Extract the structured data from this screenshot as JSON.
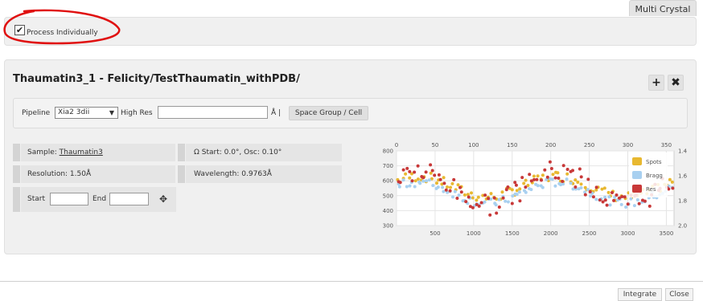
{
  "tabs": {
    "multi_crystal": "Multi Crystal"
  },
  "options": {
    "process_individually_label": "Process Individually",
    "process_individually_checked": true
  },
  "sample": {
    "title": "Thaumatin3_1 - Felicity/TestThaumatin_withPDB/",
    "pipeline_label": "Pipeline",
    "pipeline_value": "Xia2 3dii",
    "high_res_label": "High Res",
    "high_res_value": "",
    "angstrom_sep": "Å |",
    "space_group_button": "Space Group / Cell",
    "sample_label": "Sample:",
    "sample_name": "Thaumatin3",
    "omega_text": "Ω Start: 0.0°, Osc: 0.10°",
    "resolution_text": "Resolution: 1.50Å",
    "wavelength_text": "Wavelength: 0.9763Å",
    "start_label": "Start",
    "start_value": "",
    "end_label": "End",
    "end_value": ""
  },
  "icons": {
    "add": "plus-icon",
    "close": "close-icon",
    "move": "move-icon"
  },
  "chart_data": {
    "type": "scatter",
    "x_top_ticks": [
      "0",
      "50",
      "100",
      "150",
      "200",
      "250",
      "300",
      "350"
    ],
    "x_bottom_ticks": [
      "500",
      "1000",
      "1500",
      "2000",
      "2500",
      "3000",
      "3500"
    ],
    "y_left_ticks": [
      "800",
      "700",
      "600",
      "500",
      "400",
      "300"
    ],
    "y_right_ticks": [
      "1.4",
      "1.6",
      "1.8",
      "2.0"
    ],
    "x_bottom_range": [
      0,
      3600
    ],
    "y_left_range": [
      300,
      800
    ],
    "y_right_range": [
      1.4,
      2.0
    ],
    "grid": true,
    "legend_position": "right",
    "series": [
      {
        "name": "Spots",
        "color": "#e8b830",
        "axis": "left",
        "amplitude": 70,
        "offset": 560,
        "noise": 35
      },
      {
        "name": "Bragg",
        "color": "#a8d0f0",
        "axis": "left",
        "amplitude": 70,
        "offset": 520,
        "noise": 30
      },
      {
        "name": "Res",
        "color": "#c83838",
        "axis": "right",
        "amplitude": 0.13,
        "offset": 1.7,
        "noise": 0.09
      }
    ]
  },
  "footer": {
    "integrate_button": "Integrate",
    "close_button": "Close"
  }
}
